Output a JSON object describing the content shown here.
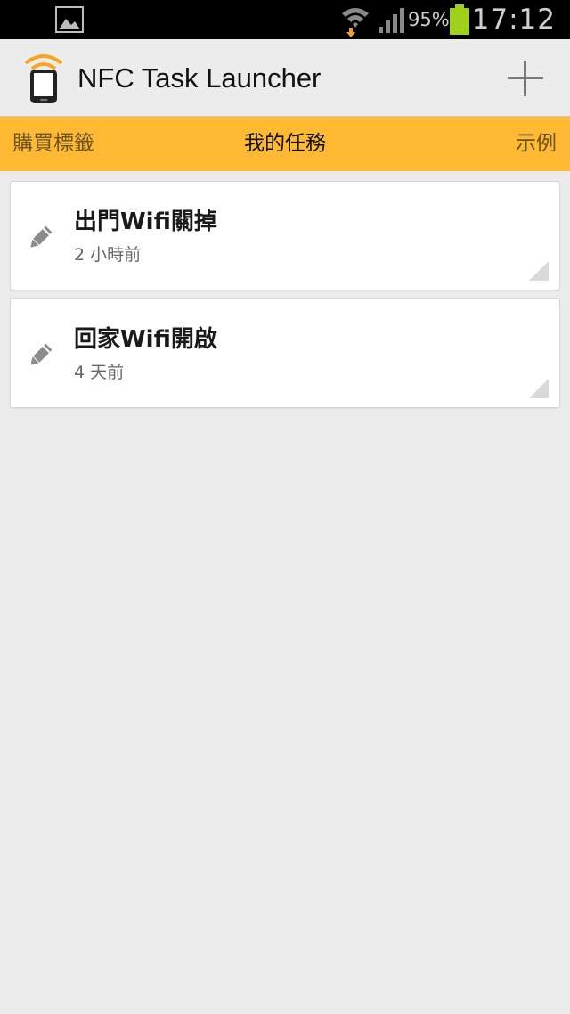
{
  "status_bar": {
    "notification_icon": "image-icon",
    "wifi_icon": "wifi-download-icon",
    "signal_icon": "signal-icon",
    "battery_percent": "95%",
    "battery_icon": "battery-icon",
    "time": "17:12"
  },
  "action_bar": {
    "app_icon": "nfc-phone-icon",
    "title": "NFC Task Launcher",
    "add_icon": "plus-icon"
  },
  "tabs": [
    {
      "label": "購買標籤"
    },
    {
      "label": "我的任務"
    },
    {
      "label": "示例"
    }
  ],
  "tasks": [
    {
      "name": "出門Wifi關掉",
      "time": "2 小時前",
      "icon": "pencil-icon"
    },
    {
      "name": "回家Wifi開啟",
      "time": "4 天前",
      "icon": "pencil-icon"
    }
  ],
  "colors": {
    "accent": "#ffb932",
    "battery": "#9fd11a",
    "wifi_arrow": "#f0a020"
  }
}
